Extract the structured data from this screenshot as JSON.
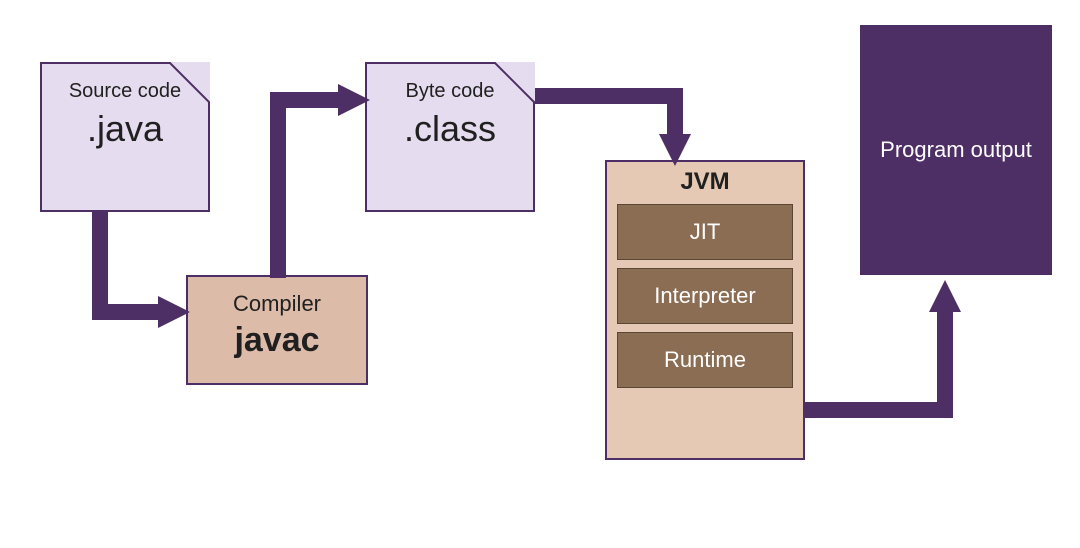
{
  "diagram": {
    "sourceFile": {
      "label": "Source code",
      "extension": ".java"
    },
    "compiler": {
      "label": "Compiler",
      "name": "javac"
    },
    "byteFile": {
      "label": "Byte code",
      "extension": ".class"
    },
    "jvm": {
      "title": "JVM",
      "parts": [
        "JIT",
        "Interpreter",
        "Runtime"
      ]
    },
    "output": {
      "label": "Program output"
    }
  },
  "colors": {
    "purple": "#4d2e65",
    "lilac": "#e6dcef",
    "tan": "#dcbba9",
    "brown": "#8b6d53"
  }
}
